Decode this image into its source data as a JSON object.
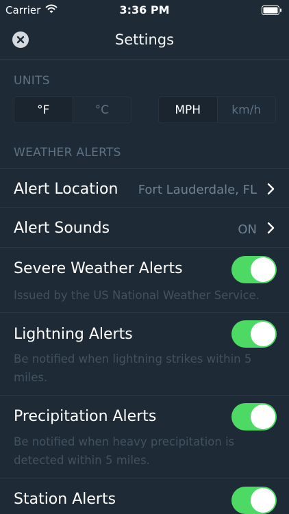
{
  "status_bar": {
    "carrier": "Carrier",
    "time": "3:36 PM"
  },
  "nav": {
    "title": "Settings"
  },
  "units": {
    "header": "UNITS",
    "temperature": {
      "options": [
        "°F",
        "°C"
      ],
      "selected": "°F"
    },
    "speed": {
      "options": [
        "MPH",
        "km/h"
      ],
      "selected": "MPH"
    }
  },
  "weather_alerts": {
    "header": "WEATHER ALERTS",
    "alert_location": {
      "label": "Alert Location",
      "value": "Fort Lauderdale, FL"
    },
    "alert_sounds": {
      "label": "Alert Sounds",
      "value": "ON"
    },
    "severe": {
      "label": "Severe Weather Alerts",
      "description": "Issued by the US National Weather Service.",
      "enabled": true
    },
    "lightning": {
      "label": "Lightning Alerts",
      "description": "Be notified when lightning strikes within 5 miles.",
      "enabled": true
    },
    "precipitation": {
      "label": "Precipitation Alerts",
      "description": "Be notified when heavy precipitation is detected within 5 miles.",
      "enabled": true
    },
    "station": {
      "label": "Station Alerts",
      "enabled": true
    }
  },
  "colors": {
    "background": "#1e2a36",
    "toggle_on": "#4cd964",
    "muted_text": "#5f7282"
  }
}
